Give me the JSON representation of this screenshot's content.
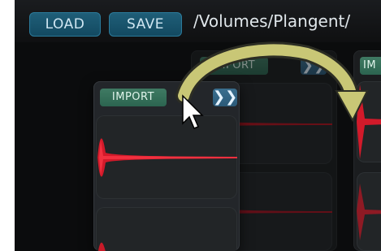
{
  "toolbar": {
    "load_label": "LOAD",
    "save_label": "SAVE",
    "path": "/Volumes/Plangent/"
  },
  "panels": [
    {
      "import_label": "IMPORT",
      "next_symbol": "❯❯"
    },
    {
      "import_label": "IMPORT",
      "next_symbol": "❯❯"
    },
    {
      "import_label": "IM"
    }
  ],
  "colors": {
    "accent_blue": "#1f5e78",
    "import_green": "#3f7a63",
    "waveform_red": "#d21a2a",
    "arrow_yellow": "#c9c776"
  }
}
